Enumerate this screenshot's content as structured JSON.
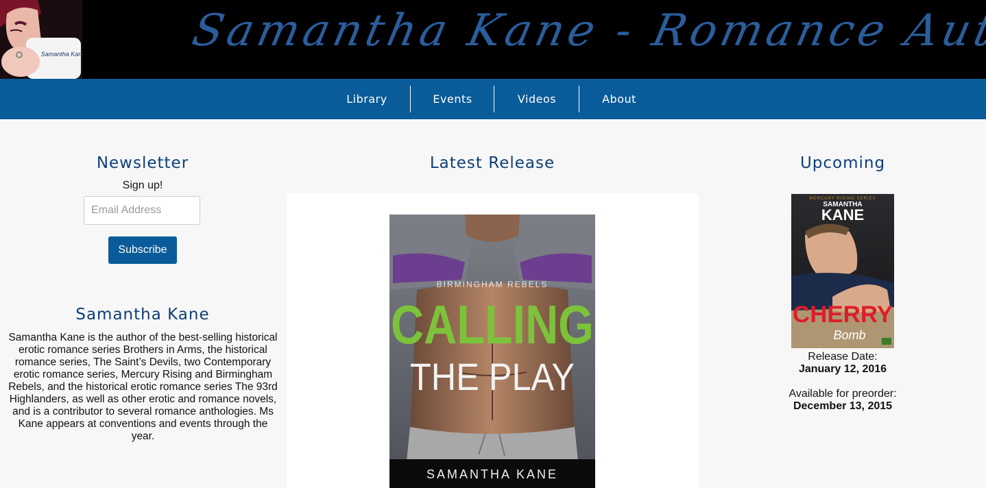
{
  "header": {
    "site_title": "Samantha Kane - Romance Author",
    "avatar_mug_text": "Samantha Kane"
  },
  "nav": {
    "items": [
      {
        "label": "Library"
      },
      {
        "label": "Events"
      },
      {
        "label": "Videos"
      },
      {
        "label": "About"
      }
    ]
  },
  "newsletter": {
    "heading": "Newsletter",
    "signup_text": "Sign up!",
    "email_placeholder": "Email Address",
    "subscribe_label": "Subscribe"
  },
  "author": {
    "heading": "Samantha Kane",
    "bio": "Samantha Kane is the author of the best-selling historical erotic romance series Brothers in Arms, the historical romance series, The Saint’s Devils, two Contemporary erotic romance series, Mercury Rising and Birmingham Rebels, and the historical erotic romance series The 93rd Highlanders, as well as other erotic and romance novels, and is a contributor to several romance anthologies. Ms Kane appears at conventions and events through the year."
  },
  "latest_release": {
    "heading": "Latest Release",
    "cover": {
      "series": "BIRMINGHAM REBELS",
      "title_line1": "CALLING",
      "title_line2": "THE PLAY",
      "author": "SAMANTHA KANE"
    }
  },
  "upcoming": {
    "heading": "Upcoming",
    "cover": {
      "series": "MERCURY RISING SERIES",
      "author_first": "SAMANTHA",
      "author_last": "KANE",
      "title_main": "CHERRY",
      "title_script": "Bomb"
    },
    "release_label": "Release Date:",
    "release_date": "January 12, 2016",
    "preorder_label": "Available for preorder:",
    "preorder_date": "December 13, 2015"
  },
  "colors": {
    "nav_bg": "#0a5b99",
    "heading": "#0d3f78",
    "title_script": "#2a5d9c",
    "page_bg": "#f7f7f7"
  }
}
